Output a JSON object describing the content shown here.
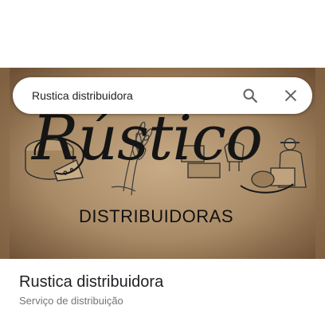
{
  "search": {
    "query": "Rustica distribuidora",
    "search_icon": "search-icon",
    "close_icon": "close-icon"
  },
  "hero": {
    "logo_script": "Rústico",
    "logo_subtitle": "DISTRIBUIDORAS"
  },
  "place": {
    "name": "Rustica distribuidora",
    "category": "Serviço de distribuição"
  },
  "colors": {
    "parchment": "#a88a66",
    "searchbar_bg": "#ffffff",
    "icon": "#5f6368",
    "title_text": "#202124",
    "category_text": "#70757a"
  }
}
